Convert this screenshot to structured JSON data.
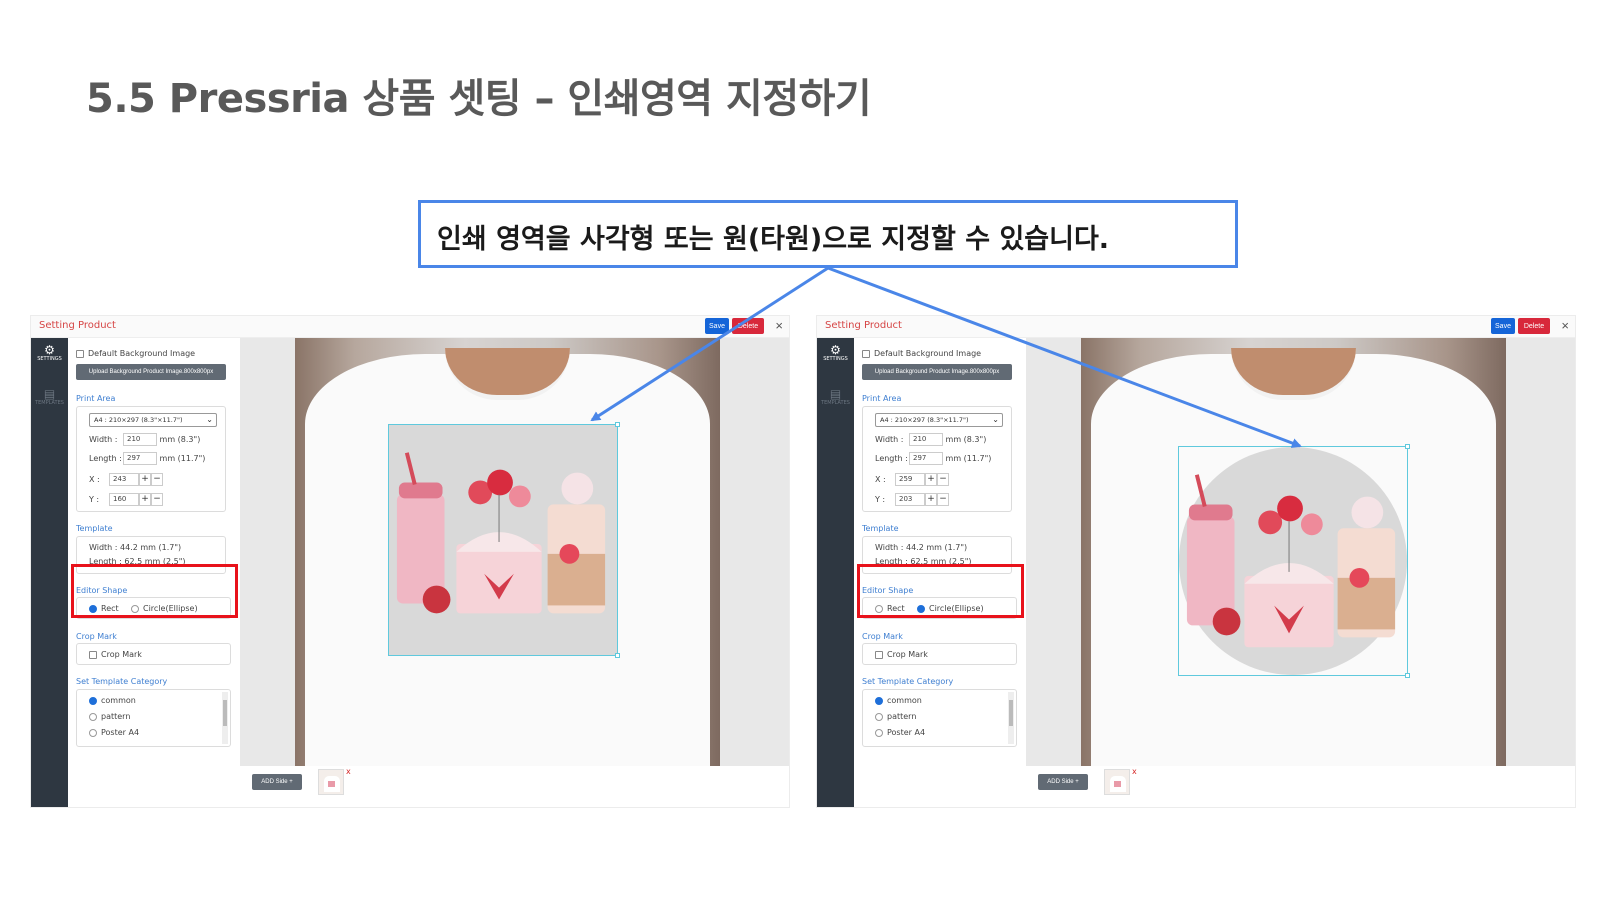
{
  "slide": {
    "title": "5.5 Pressria 상품 셋팅 – 인쇄영역 지정하기",
    "callout": "인쇄 영역을 사각형 또는 원(타원)으로 지정할 수 있습니다."
  },
  "colors": {
    "accent_blue": "#4a86e8",
    "highlight_red": "#e8121b",
    "sidebar_dark": "#2e3741",
    "section_blue": "#3f7fd1",
    "print_area_border": "#5fc9dd"
  },
  "panels": [
    {
      "window_title": "Setting Product",
      "save_label": "Save",
      "delete_label": "Delete",
      "close_icon": "×",
      "sidebar": {
        "settings_label": "SETTINGS",
        "templates_label": "TEMPLATES"
      },
      "default_bg_label": "Default Background Image",
      "upload_label": "Upload Background Product Image.800x800px",
      "print_area": {
        "section": "Print Area",
        "select_value": "A4 : 210×297 (8.3\"×11.7\")",
        "width_label": "Width :",
        "width_value": "210",
        "width_unit": "mm (8.3\")",
        "length_label": "Length :",
        "length_value": "297",
        "length_unit": "mm (11.7\")",
        "x_label": "X :",
        "x_value": "243",
        "y_label": "Y :",
        "y_value": "160",
        "plus": "+",
        "minus": "−"
      },
      "template": {
        "section": "Template",
        "width_line": "Width :   44.2 mm (1.7\")",
        "length_line": "Length :  62.5 mm (2.5\")"
      },
      "editor_shape": {
        "section": "Editor Shape",
        "options": [
          "Rect",
          "Circle(Ellipse)"
        ],
        "selected": "Rect"
      },
      "crop_mark": {
        "section": "Crop Mark",
        "label": "Crop Mark"
      },
      "template_category": {
        "section": "Set Template Category",
        "options": [
          "common",
          "pattern",
          "Poster A4"
        ],
        "selected": "common"
      },
      "add_side_label": "ADD Side +",
      "thumb_remove": "x"
    },
    {
      "window_title": "Setting Product",
      "save_label": "Save",
      "delete_label": "Delete",
      "close_icon": "×",
      "sidebar": {
        "settings_label": "SETTINGS",
        "templates_label": "TEMPLATES"
      },
      "default_bg_label": "Default Background Image",
      "upload_label": "Upload Background Product Image.800x800px",
      "print_area": {
        "section": "Print Area",
        "select_value": "A4 : 210×297 (8.3\"×11.7\")",
        "width_label": "Width :",
        "width_value": "210",
        "width_unit": "mm (8.3\")",
        "length_label": "Length :",
        "length_value": "297",
        "length_unit": "mm (11.7\")",
        "x_label": "X :",
        "x_value": "259",
        "y_label": "Y :",
        "y_value": "203",
        "plus": "+",
        "minus": "−"
      },
      "template": {
        "section": "Template",
        "width_line": "Width :   44.2 mm (1.7\")",
        "length_line": "Length :  62.5 mm (2.5\")"
      },
      "editor_shape": {
        "section": "Editor Shape",
        "options": [
          "Rect",
          "Circle(Ellipse)"
        ],
        "selected": "Circle(Ellipse)"
      },
      "crop_mark": {
        "section": "Crop Mark",
        "label": "Crop Mark"
      },
      "template_category": {
        "section": "Set Template Category",
        "options": [
          "common",
          "pattern",
          "Poster A4"
        ],
        "selected": "common"
      },
      "add_side_label": "ADD Side +",
      "thumb_remove": "x"
    }
  ]
}
